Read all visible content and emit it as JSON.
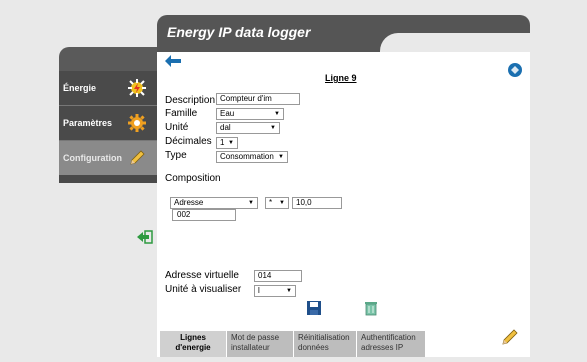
{
  "header": {
    "title": "Energy IP data logger"
  },
  "sidebar": {
    "items": [
      {
        "label": "Énergie",
        "icon": "energy-icon"
      },
      {
        "label": "Paramètres",
        "icon": "gear-icon"
      },
      {
        "label": "Configuration",
        "icon": "pencil-icon"
      }
    ]
  },
  "form": {
    "section_title": "Ligne 9",
    "description_label": "Description",
    "description_value": "Compteur d'im",
    "famille_label": "Famille",
    "famille_value": "Eau",
    "unite_label": "Unité",
    "unite_value": "dal",
    "decimales_label": "Décimales",
    "decimales_value": "1",
    "type_label": "Type",
    "type_value": "Consommation",
    "composition_title": "Composition",
    "composition": {
      "source_value": "Adresse",
      "operator_value": "*",
      "factor_value": "10,0",
      "address_value": "002"
    },
    "adresse_virtuelle_label": "Adresse virtuelle",
    "adresse_virtuelle_value": "014",
    "unite_visualiser_label": "Unité à visualiser",
    "unite_visualiser_value": "l"
  },
  "tabs": [
    {
      "label_line1": "Lignes",
      "label_line2": "d'energie"
    },
    {
      "label_line1": "Mot de passe",
      "label_line2": "installateur"
    },
    {
      "label_line1": "Réinitialisation",
      "label_line2": "données"
    },
    {
      "label_line1": "Authentification",
      "label_line2": "adresses IP"
    }
  ],
  "colors": {
    "accent": "#1a6fb0",
    "header_bg": "#555555",
    "sidebar_bg": "#4a4a4a",
    "active_item": "#8a8a8a"
  }
}
